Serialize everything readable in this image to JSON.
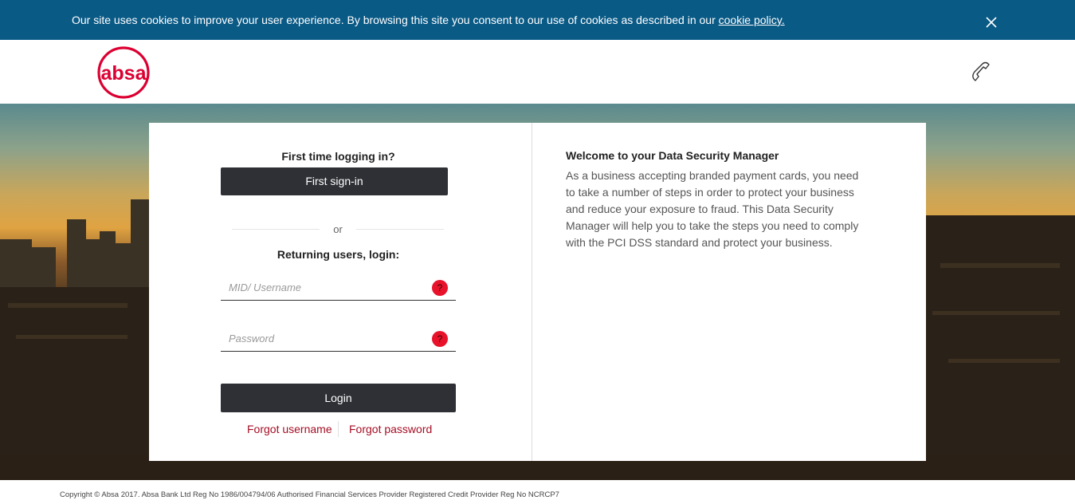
{
  "cookie_banner": {
    "text": "Our site uses cookies to improve your user experience. By browsing this site you consent to our use of cookies as described in our ",
    "link_label": "cookie policy.",
    "close_icon": "close-icon"
  },
  "header": {
    "logo_text": "absa",
    "phone_icon": "phone-icon"
  },
  "login": {
    "first_time_heading": "First time logging in?",
    "first_signin_label": "First sign-in",
    "or_label": "or",
    "returning_heading": "Returning users, login:",
    "username_placeholder": "MID/ Username",
    "password_placeholder": "Password",
    "help_glyph": "?",
    "login_label": "Login",
    "forgot_username_label": "Forgot username",
    "forgot_password_label": "Forgot password"
  },
  "welcome": {
    "title": "Welcome to your Data Security Manager",
    "body": "As a business accepting branded payment cards, you need to take a number of steps in order to protect your business and reduce your exposure to fraud. This Data Security Manager will help you to take the steps you need to comply with the PCI DSS standard and protect your business."
  },
  "footer": {
    "copyright": "Copyright © Absa 2017. Absa Bank Ltd Reg No 1986/004794/06 Authorised Financial Services Provider Registered Credit Provider Reg No NCRCP7"
  },
  "colors": {
    "banner": "#0a5a86",
    "brand_red": "#dc0032",
    "link_red": "#a50e24",
    "button_dark": "#2e3035"
  }
}
